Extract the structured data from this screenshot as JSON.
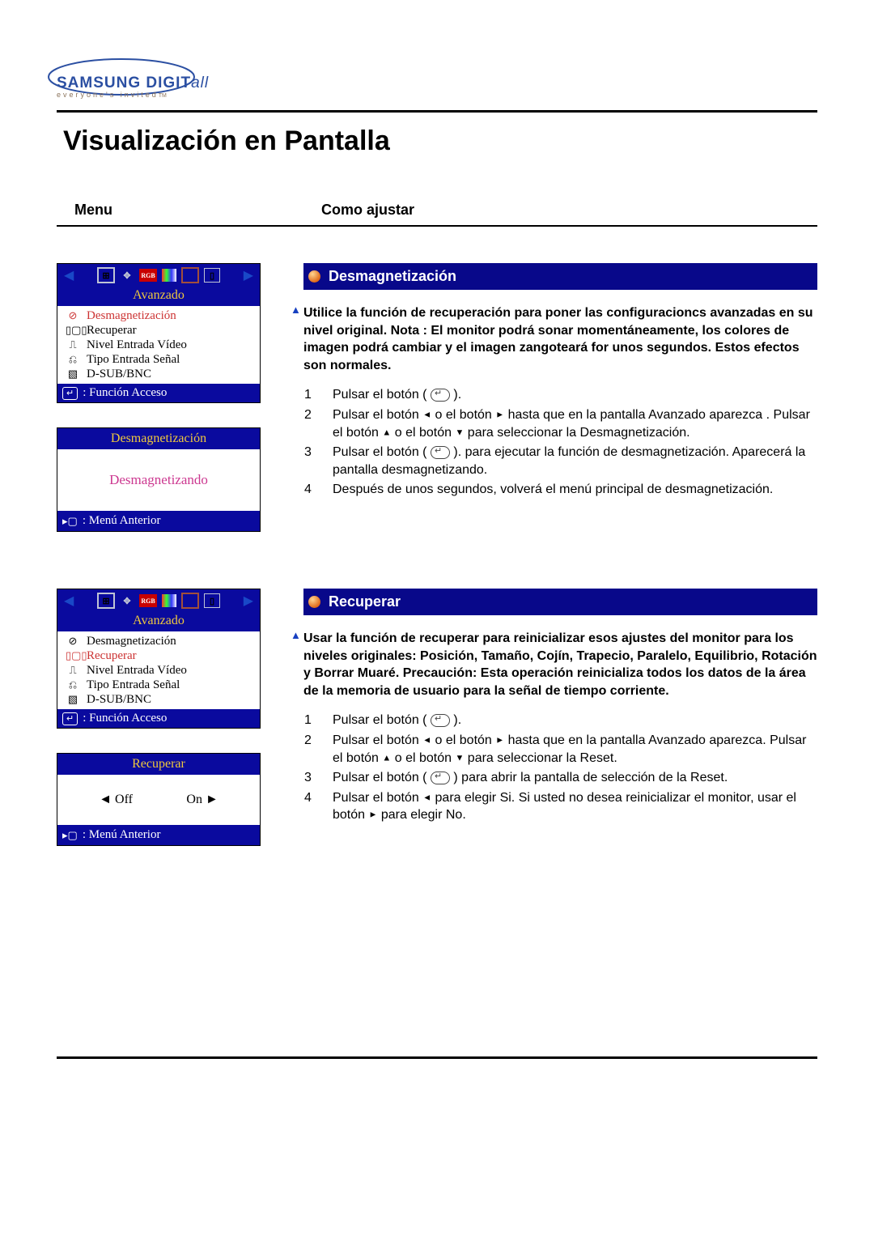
{
  "header": {
    "brand_main": "SAMSUNG",
    "brand_sub": "DIGIT",
    "brand_ital": "all",
    "tagline": "everyone's invited",
    "tagline_tm": "TM"
  },
  "page_title": "Visualización en Pantalla",
  "col_headers": {
    "menu": "Menu",
    "adjust": "Como ajustar"
  },
  "osd1": {
    "subtitle": "Avanzado",
    "items": [
      {
        "icon": "⊘",
        "label": "Desmagnetización",
        "sel": true
      },
      {
        "icon": "▯▢▯",
        "label": "Recuperar",
        "sel": false
      },
      {
        "icon": "⎍",
        "label": "Nivel Entrada Vídeo",
        "sel": false
      },
      {
        "icon": "⎌",
        "label": "Tipo Entrada Señal",
        "sel": false
      },
      {
        "icon": "▧",
        "label": "D-SUB/BNC",
        "sel": false
      }
    ],
    "footer": ": Función Acceso",
    "panel_title": "Desmagnetización",
    "panel_body": "Desmagnetizando",
    "panel_footer": ": Menú Anterior"
  },
  "osd2": {
    "subtitle": "Avanzado",
    "items": [
      {
        "icon": "⊘",
        "label": "Desmagnetización",
        "sel": false
      },
      {
        "icon": "▯▢▯",
        "label": "Recuperar",
        "sel": true
      },
      {
        "icon": "⎍",
        "label": "Nivel Entrada Vídeo",
        "sel": false
      },
      {
        "icon": "⎌",
        "label": "Tipo Entrada Señal",
        "sel": false
      },
      {
        "icon": "▧",
        "label": "D-SUB/BNC",
        "sel": false
      }
    ],
    "footer": ": Función Acceso",
    "panel_title": "Recuperar",
    "off": "◄ Off",
    "on": "On ►",
    "panel_footer": ": Menú Anterior"
  },
  "section1": {
    "title": "Desmagnetización",
    "intro": "Utilice la función de recuperación para poner las configuracioncs avanzadas en su nivel original.\nNota : El monitor podrá sonar momentáneamente, los colores de imagen podrá cambiar y el imagen zangoteará for unos segundos. Estos efectos son normales.",
    "steps": [
      "Pulsar el botón ( [↵] ).",
      "Pulsar el botón ◄ o el botón ► hasta que en la pantalla Avanzado aparezca . Pulsar el botón ▲ o el botón ▼ para seleccionar la Desmagnetización.",
      "Pulsar el botón ( [↵] ). para ejecutar la función de desmagnetización. Aparecerá la pantalla desmagnetizando.",
      "Después de unos segundos, volverá el menú principal de desmagnetización."
    ]
  },
  "section2": {
    "title": "Recuperar",
    "intro": "Usar la función de recuperar para reinicializar esos ajustes del monitor para los niveles originales: Posición, Tamaño, Cojín, Trapecio, Paralelo, Equilibrio, Rotación y Borrar Muaré.\nPrecaución: Esta operación reinicializa todos los datos de la área de la memoria de usuario para la señal de tiempo corriente.",
    "steps": [
      "Pulsar el botón ( [↵] ).",
      "Pulsar el botón ◄ o el botón ► hasta que en la pantalla Avanzado aparezca. Pulsar el botón ▲ o el botón ▼ para seleccionar la Reset.",
      "Pulsar el botón ( [↵] ) para abrir la pantalla de selección de la Reset.",
      "Pulsar el botón ◄ para elegir Si. Si usted no desea reinicializar el monitor, usar el botón ► para elegir No."
    ]
  }
}
